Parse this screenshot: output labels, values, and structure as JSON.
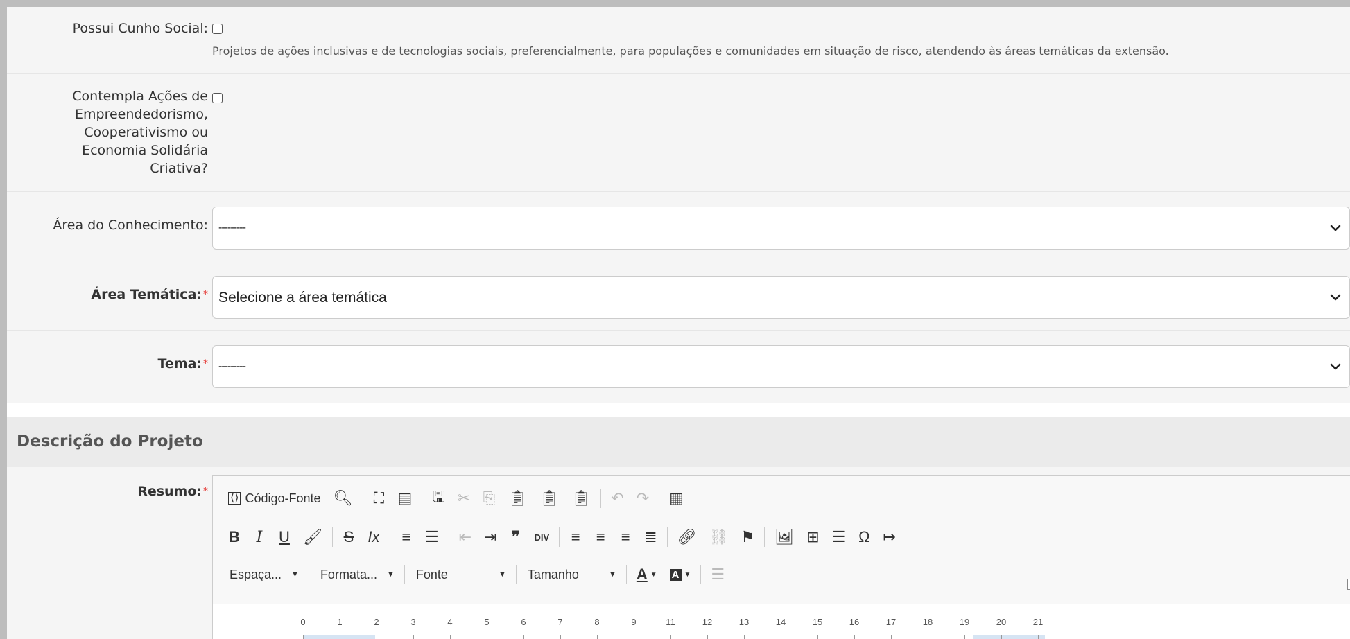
{
  "form": {
    "cunho_social": {
      "label": "Possui Cunho Social:",
      "checked": false,
      "help": "Projetos de ações inclusivas e de tecnologias sociais, preferencialmente, para populações e comunidades em situação de risco, atendendo às áreas temáticas da extensão."
    },
    "empreendedorismo": {
      "label_lines": [
        "Contempla Ações de",
        "Empreendedorismo,",
        "Cooperativismo ou",
        "Economia Solidária",
        "Criativa?"
      ],
      "checked": false
    },
    "area_conhecimento": {
      "label": "Área do Conhecimento:",
      "value": "---------"
    },
    "area_tematica": {
      "label": "Área Temática:",
      "required": "*",
      "value": "Selecione a área temática"
    },
    "tema": {
      "label": "Tema:",
      "required": "*",
      "value": "---------"
    }
  },
  "section": {
    "title": "Descrição do Projeto"
  },
  "resumo": {
    "label": "Resumo:",
    "required": "*",
    "toolbar": {
      "source_label": "Código-Fonte",
      "combos": [
        {
          "name": "spacing",
          "label": "Espaça..."
        },
        {
          "name": "format",
          "label": "Formata..."
        },
        {
          "name": "font",
          "label": "Fonte"
        },
        {
          "name": "size",
          "label": "Tamanho"
        }
      ]
    },
    "ruler": {
      "ticks": [
        "0",
        "1",
        "2",
        "3",
        "4",
        "5",
        "6",
        "7",
        "8",
        "9",
        "11",
        "12",
        "13",
        "14",
        "15",
        "16",
        "17",
        "18",
        "19",
        "20",
        "21"
      ]
    }
  },
  "icons": {
    "checkbox": "checkbox-icon",
    "select_arrow": "chevron-down-icon"
  }
}
